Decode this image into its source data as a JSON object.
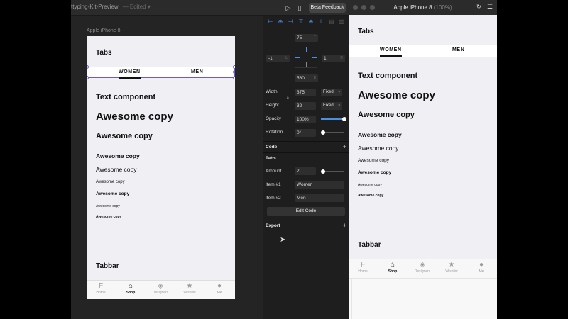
{
  "editor": {
    "doc_title": "ttyping-Kit-Preview",
    "edited_label": "— Edited",
    "beta_button": "Beta Feedback",
    "device_label": "Apple iPhone 8"
  },
  "artboard": {
    "tabs_heading": "Tabs",
    "tab_women": "WOMEN",
    "tab_men": "MEN",
    "text_component": "Text component",
    "copies": [
      "Awesome copy",
      "Awesome copy",
      "Awesome copy",
      "Awesome copy",
      "Awesome copy",
      "Awesome copy",
      "Awesome copy",
      "Awesome copy"
    ],
    "tabbar_heading": "Tabbar",
    "tabbar": [
      {
        "label": "Home",
        "icon": "home-f-icon"
      },
      {
        "label": "Shop",
        "icon": "hanger-icon"
      },
      {
        "label": "Designers",
        "icon": "tag-icon"
      },
      {
        "label": "Wishlist",
        "icon": "star-icon"
      },
      {
        "label": "Me",
        "icon": "person-icon"
      }
    ]
  },
  "props": {
    "top": "75",
    "top_unit": "T",
    "left": "-1",
    "left_unit": "L",
    "right": "1",
    "right_unit": "R",
    "bottom": "560",
    "bottom_unit": "B",
    "width_label": "Width",
    "width": "375",
    "width_mode": "Fixed",
    "height_label": "Height",
    "height": "32",
    "height_mode": "Fixed",
    "opacity_label": "Opacity",
    "opacity": "100%",
    "opacity_level": 1.0,
    "rotation_label": "Rotation",
    "rotation": "0°",
    "code_section": "Code",
    "tabs_section": "Tabs",
    "amount_label": "Amount",
    "amount": "2",
    "item1_label": "Item #1",
    "item1": "Women",
    "item2_label": "Item #2",
    "item2": "Men",
    "edit_code": "Edit Code",
    "export_section": "Export"
  },
  "preview": {
    "title": "Apple iPhone 8",
    "zoom": "(100%)"
  },
  "colors": {
    "accent": "#4a90e2",
    "selection": "#6a5acd"
  }
}
